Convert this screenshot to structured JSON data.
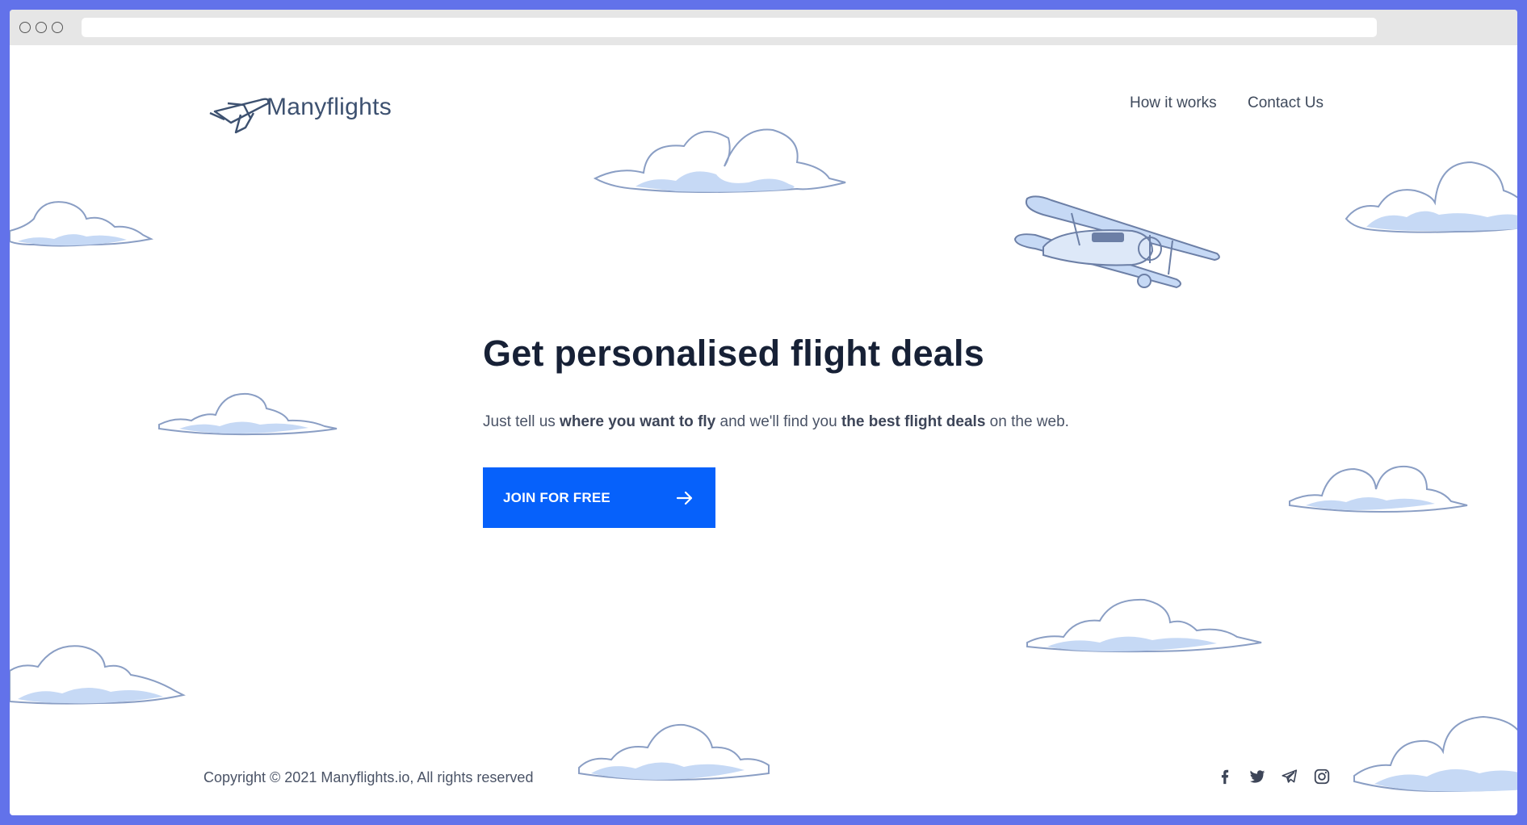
{
  "brand": {
    "name": "Manyflights"
  },
  "nav": {
    "how_it_works": "How it works",
    "contact_us": "Contact Us"
  },
  "hero": {
    "title": "Get personalised flight deals",
    "subtitle_1": "Just tell us ",
    "subtitle_bold_1": "where you want to fly",
    "subtitle_2": " and we'll find you ",
    "subtitle_bold_2": "the best flight deals",
    "subtitle_3": " on the web.",
    "cta_label": "JOIN FOR FREE"
  },
  "footer": {
    "copyright": "Copyright © 2021 Manyflights.io, All rights reserved",
    "social_icons": [
      "facebook-icon",
      "twitter-icon",
      "telegram-icon",
      "instagram-icon"
    ]
  },
  "colors": {
    "frame": "#6272ea",
    "accent": "#0661fb",
    "heading": "#172136",
    "cloud_fill": "#c6d9f5",
    "cloud_stroke": "#8a9ec4"
  }
}
